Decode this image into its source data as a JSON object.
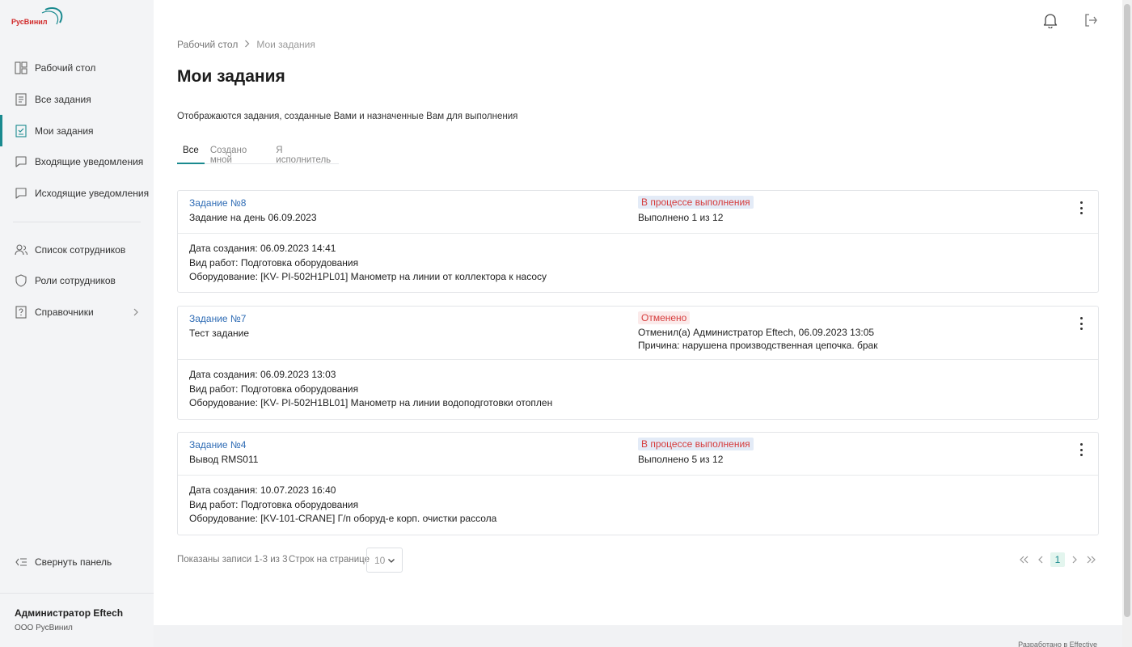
{
  "brand": {
    "logo_text": "РусВинил",
    "accent_color": "#1a8a8f",
    "link_color": "#2f6cb5",
    "status_color": "#d63c3c"
  },
  "sidebar": {
    "nav": [
      {
        "label": "Рабочий стол",
        "icon": "dashboard-icon"
      },
      {
        "label": "Все задания",
        "icon": "tasks-icon"
      },
      {
        "label": "Мои задания",
        "icon": "my-tasks-icon",
        "active": true
      },
      {
        "label": "Входящие уведомления",
        "icon": "message-icon"
      },
      {
        "label": "Исходящие уведомления",
        "icon": "message-icon"
      }
    ],
    "nav2": [
      {
        "label": "Список сотрудников",
        "icon": "users-icon"
      },
      {
        "label": "Роли сотрудников",
        "icon": "shield-icon"
      },
      {
        "label": "Справочники",
        "icon": "help-book-icon"
      }
    ],
    "collapse_label": "Свернуть панель",
    "user": {
      "name": "Администратор Eftech",
      "org": "ООО РусВинил"
    }
  },
  "topbar": {
    "icons": [
      "bell-icon",
      "logout-icon"
    ]
  },
  "breadcrumb": {
    "items": [
      "Рабочий стол",
      "Мои задания"
    ]
  },
  "page": {
    "title": "Мои задания",
    "subtitle": "Отображаются задания, созданные Вами и назначенные Вам для выполнения",
    "tabs": [
      "Все",
      "Создано мной",
      "Я исполнитель"
    ],
    "active_tab": "Все"
  },
  "tasks": [
    {
      "link": "Задание №8",
      "name": "Задание на день 06.09.2023",
      "status": "В процессе выполнения",
      "status_lines": [
        "Выполнено 1 из 12"
      ],
      "details": [
        "Дата создания: 06.09.2023 14:41",
        "Вид работ: Подготовка оборудования",
        "Оборудование: [KV- PI-502H1PL01] Манометр на линии от коллектора к насосу"
      ]
    },
    {
      "link": "Задание №7",
      "name": "Тест задание",
      "status": "Отменено",
      "status_lines": [
        "Отменил(а) Администратор Eftech, 06.09.2023 13:05",
        "Причина: нарушена производственная цепочка. брак"
      ],
      "details": [
        "Дата создания: 06.09.2023 13:03",
        "Вид работ: Подготовка оборудования",
        "Оборудование: [KV- PI-502H1BL01] Манометр на линии водоподготовки отоплен"
      ]
    },
    {
      "link": "Задание №4",
      "name": "Вывод RMS011",
      "status": "В процессе выполнения",
      "status_lines": [
        "Выполнено 5 из 12"
      ],
      "details": [
        "Дата создания: 10.07.2023 16:40",
        "Вид работ: Подготовка оборудования",
        "Оборудование: [KV-101-CRANE] Г/п оборуд-е корп. очистки рассола"
      ]
    }
  ],
  "pagination": {
    "shown": "Показаны записи 1-3 из 3",
    "rows_label": "Строк на странице",
    "rows_value": "10",
    "current_page": "1"
  },
  "footer": {
    "dev_text": "Разработано в   Effective"
  }
}
